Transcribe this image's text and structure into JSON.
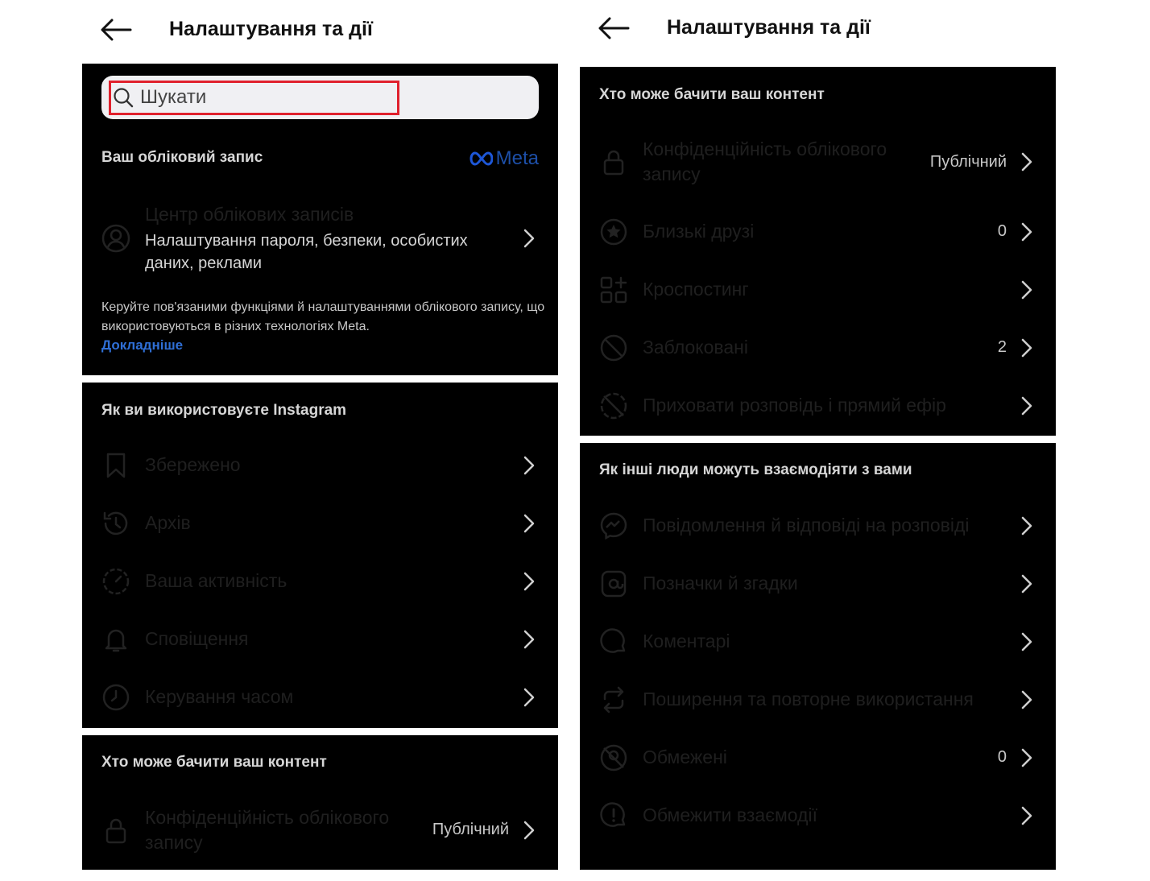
{
  "header": {
    "title": "Налаштування та дії"
  },
  "search": {
    "placeholder": "Шукати"
  },
  "account_section": {
    "title": "Ваш обліковий запис",
    "brand": "Meta",
    "accounts_center": {
      "title": "Центр облікових записів",
      "description": "Налаштування пароля, безпеки, особистих даних, реклами"
    },
    "note": "Керуйте пов'язаними функціями й налаштуваннями облікового запису, що використовуються в різних технологіях Meta.",
    "learn_more": "Докладніше"
  },
  "usage_section": {
    "title": "Як ви використовуєте Instagram",
    "items": [
      {
        "label": "Збережено",
        "icon": "bookmark-icon"
      },
      {
        "label": "Архів",
        "icon": "history-icon"
      },
      {
        "label": "Ваша активність",
        "icon": "activity-icon"
      },
      {
        "label": "Сповіщення",
        "icon": "bell-icon"
      },
      {
        "label": "Керування часом",
        "icon": "clock-icon"
      }
    ]
  },
  "visibility_section": {
    "title": "Хто може бачити ваш контент",
    "items": [
      {
        "label": "Конфіденційність облікового запису",
        "value": "Публічний",
        "icon": "lock-icon"
      },
      {
        "label": "Близькі друзі",
        "value": "0",
        "icon": "star-icon"
      },
      {
        "label": "Кроспостинг",
        "value": "",
        "icon": "crosspost-icon"
      },
      {
        "label": "Заблоковані",
        "value": "2",
        "icon": "block-icon"
      },
      {
        "label": "Приховати розповідь і прямий ефір",
        "value": "",
        "icon": "hide-story-icon"
      }
    ]
  },
  "interactions_section": {
    "title": "Як інші люди можуть взаємодіяти з вами",
    "items": [
      {
        "label": "Повідомлення й відповіді на розповіді",
        "value": "",
        "icon": "messenger-icon"
      },
      {
        "label": "Позначки й згадки",
        "value": "",
        "icon": "at-icon"
      },
      {
        "label": "Коментарі",
        "value": "",
        "icon": "comment-icon"
      },
      {
        "label": "Поширення та повторне використання",
        "value": "",
        "icon": "repost-icon"
      },
      {
        "label": "Обмежені",
        "value": "0",
        "icon": "restricted-icon"
      },
      {
        "label": "Обмежити взаємодії",
        "value": "",
        "icon": "limit-icon"
      }
    ]
  },
  "colors": {
    "card_background": "#000000",
    "highlight": "#e0212d",
    "link": "#2f6fd6",
    "meta_brand": "#1d4fa8"
  }
}
